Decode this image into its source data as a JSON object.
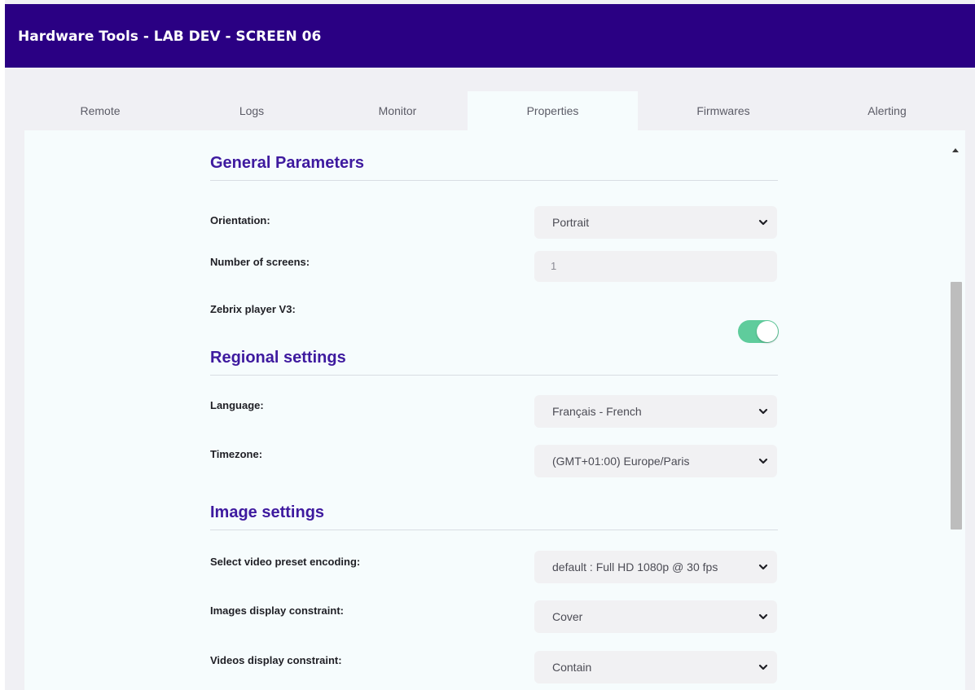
{
  "header": {
    "title": "Hardware Tools - LAB DEV - SCREEN 06"
  },
  "tabs": [
    {
      "label": "Remote"
    },
    {
      "label": "Logs"
    },
    {
      "label": "Monitor"
    },
    {
      "label": "Properties",
      "active": true
    },
    {
      "label": "Firmwares"
    },
    {
      "label": "Alerting"
    }
  ],
  "sections": {
    "general": {
      "title": "General Parameters",
      "orientation": {
        "label": "Orientation:",
        "value": "Portrait"
      },
      "screens": {
        "label": "Number of screens:",
        "value": "1"
      },
      "player": {
        "label": "Zebrix player V3:",
        "enabled": true
      }
    },
    "regional": {
      "title": "Regional settings",
      "language": {
        "label": "Language:",
        "value": "Français - French"
      },
      "timezone": {
        "label": "Timezone:",
        "value": "(GMT+01:00) Europe/Paris"
      }
    },
    "image": {
      "title": "Image settings",
      "preset": {
        "label": "Select video preset encoding:",
        "value": "default : Full HD 1080p @ 30 fps"
      },
      "images": {
        "label": "Images display constraint:",
        "value": "Cover"
      },
      "videos": {
        "label": "Videos display constraint:",
        "value": "Contain"
      }
    }
  },
  "colors": {
    "header_bg": "#2a0083",
    "accent": "#3e1a9f",
    "toggle_on": "#5fcc9c"
  },
  "icons": {
    "dropdown": "chevron-down-icon",
    "scroll_up": "scroll-up-arrow-icon"
  }
}
